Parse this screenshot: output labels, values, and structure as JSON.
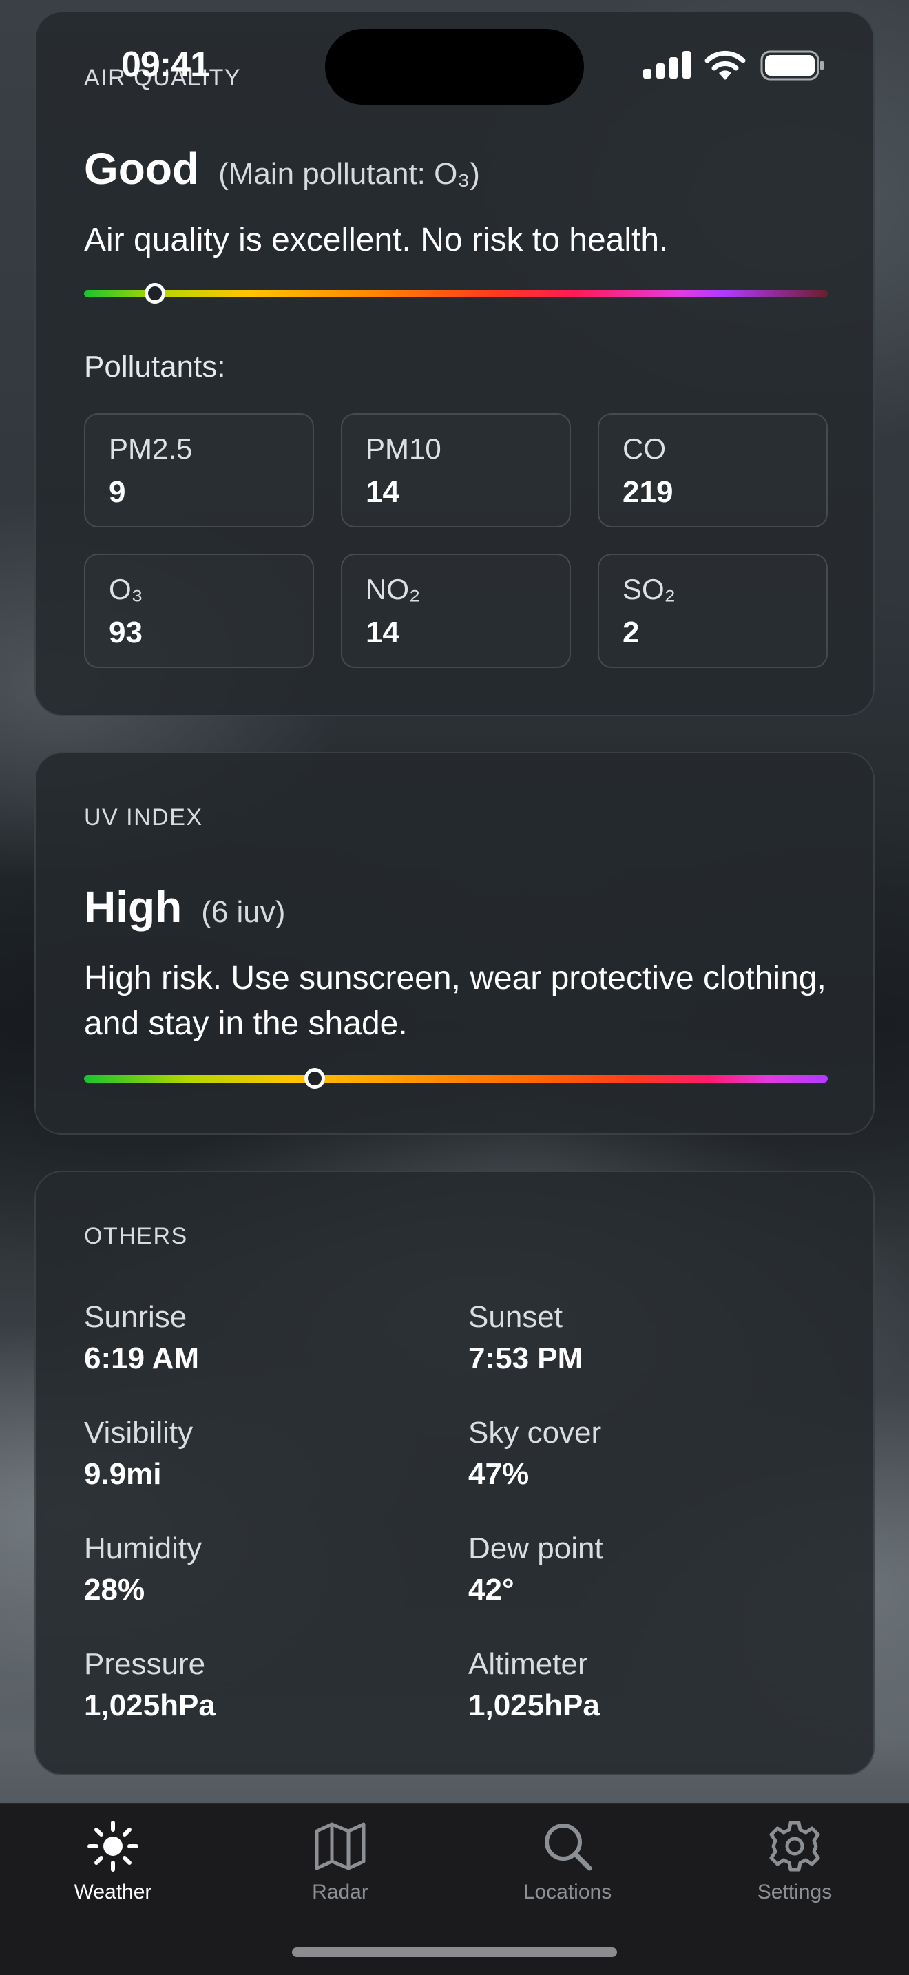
{
  "status_bar": {
    "time": "09:41"
  },
  "air_quality": {
    "section_title": "AIR QUALITY",
    "level": "Good",
    "main_pollutant": "(Main pollutant: O₃)",
    "description": "Air quality is excellent. No risk to health.",
    "scale_position": 0.095,
    "pollutants_label": "Pollutants:",
    "pollutants": [
      {
        "name": "PM2.5",
        "value": "9"
      },
      {
        "name": "PM10",
        "value": "14"
      },
      {
        "name": "CO",
        "value": "219"
      },
      {
        "name": "O₃",
        "value": "93"
      },
      {
        "name": "NO₂",
        "value": "14"
      },
      {
        "name": "SO₂",
        "value": "2"
      }
    ]
  },
  "uv_index": {
    "section_title": "UV INDEX",
    "level": "High",
    "value_text": "(6 iuv)",
    "description": "High risk. Use sunscreen, wear protective clothing, and stay in the shade.",
    "scale_position": 0.31
  },
  "others": {
    "section_title": "OTHERS",
    "items": [
      {
        "label": "Sunrise",
        "value": "6:19 AM"
      },
      {
        "label": "Sunset",
        "value": "7:53 PM"
      },
      {
        "label": "Visibility",
        "value": "9.9mi"
      },
      {
        "label": "Sky cover",
        "value": "47%"
      },
      {
        "label": "Humidity",
        "value": "28%"
      },
      {
        "label": "Dew point",
        "value": "42°"
      },
      {
        "label": "Pressure",
        "value": "1,025hPa"
      },
      {
        "label": "Altimeter",
        "value": "1,025hPa"
      }
    ]
  },
  "tab_bar": {
    "tabs": [
      {
        "label": "Weather",
        "icon": "sun-icon",
        "active": true
      },
      {
        "label": "Radar",
        "icon": "map-icon",
        "active": false
      },
      {
        "label": "Locations",
        "icon": "search-icon",
        "active": false
      },
      {
        "label": "Settings",
        "icon": "gear-icon",
        "active": false
      }
    ]
  },
  "colors": {
    "card_background": "#24292e",
    "tab_bar_background": "#1b1b1d",
    "active_tab": "#ffffff",
    "inactive_tab": "#8c8f93"
  }
}
